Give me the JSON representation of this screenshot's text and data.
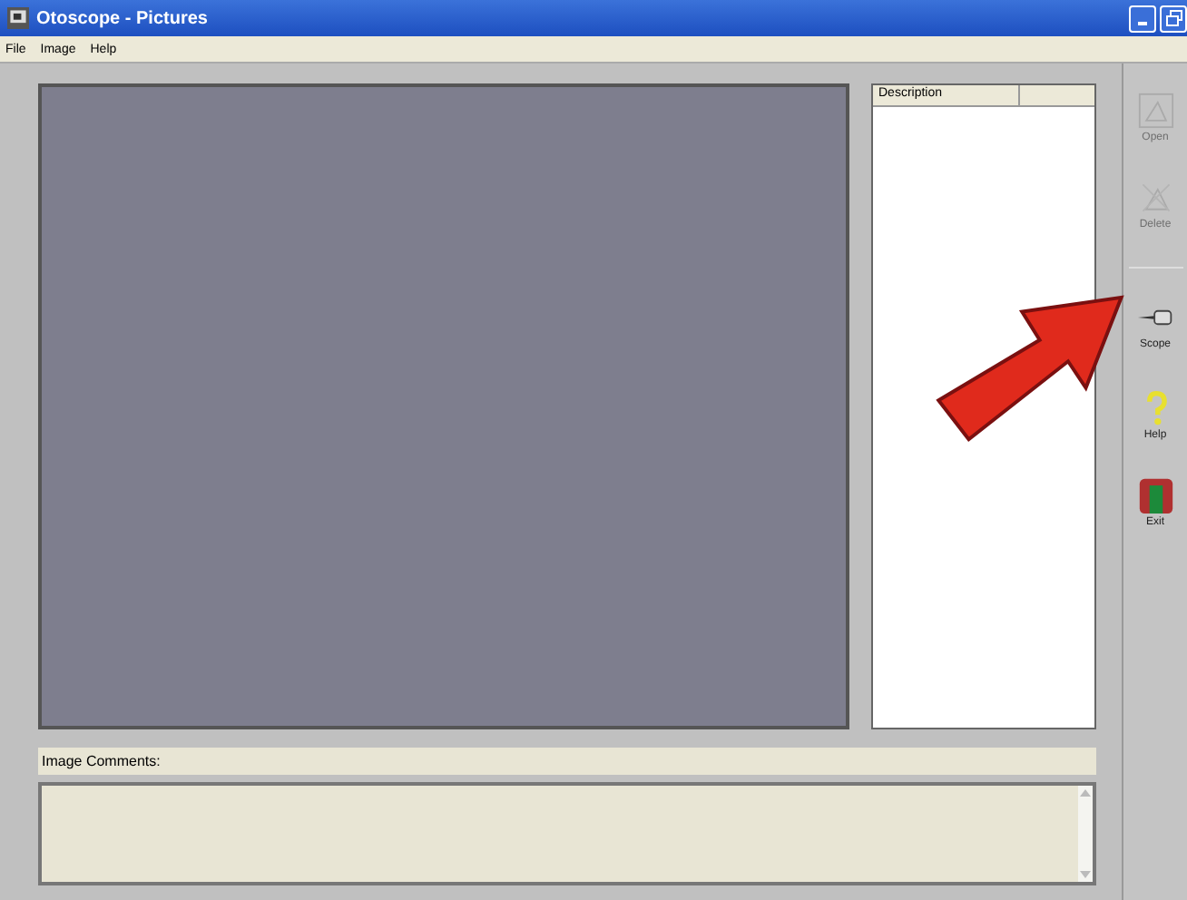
{
  "window": {
    "title": "Otoscope - Pictures"
  },
  "menu": [
    {
      "label": "File"
    },
    {
      "label": "Image"
    },
    {
      "label": "Help"
    }
  ],
  "list": {
    "columns": [
      "Description"
    ]
  },
  "comments": {
    "label": "Image Comments:"
  },
  "toolbar": [
    {
      "kind": "open",
      "label": "Open",
      "disabled": true
    },
    {
      "kind": "delete",
      "label": "Delete",
      "disabled": true
    },
    {
      "kind": "scope",
      "label": "Scope",
      "disabled": false
    },
    {
      "kind": "help",
      "label": "Help",
      "disabled": false
    },
    {
      "kind": "exit",
      "label": "Exit",
      "disabled": false
    }
  ]
}
